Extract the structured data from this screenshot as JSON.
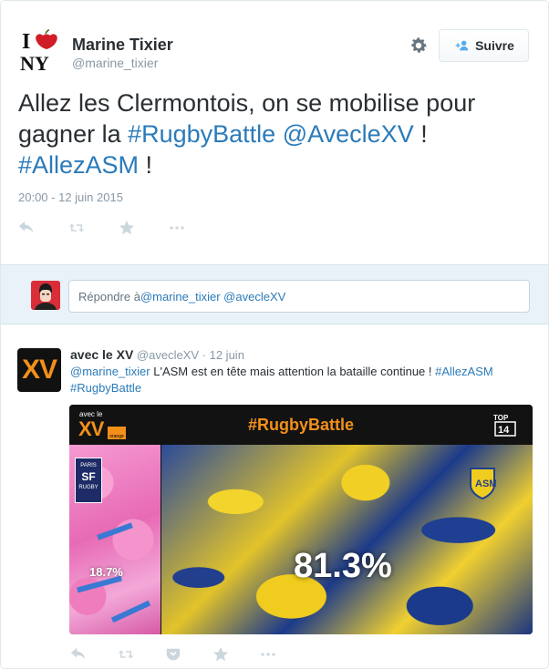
{
  "main_tweet": {
    "author_name": "Marine Tixier",
    "author_handle": "@marine_tixier",
    "follow_label": "Suivre",
    "text_parts": [
      {
        "text": "Allez les Clermontois, on se mobilise pour gagner la ",
        "link": false
      },
      {
        "text": "#RugbyBattle",
        "link": true
      },
      {
        "text": " ",
        "link": false
      },
      {
        "text": "@AvecleXV",
        "link": true
      },
      {
        "text": " ! ",
        "link": false
      },
      {
        "text": "#AllezASM",
        "link": true
      },
      {
        "text": " !",
        "link": false
      }
    ],
    "timestamp": "20:00 - 12 juin 2015",
    "logo_text_top": "I",
    "logo_text_bottom": "NY"
  },
  "reply_box": {
    "prefix": "Répondre à ",
    "mentions": "@marine_tixier @avecleXV"
  },
  "reply_tweet": {
    "author_name": "avec le XV",
    "author_handle": "@avecleXV",
    "date": "12 juin",
    "avatar_text": "XV",
    "text_parts": [
      {
        "text": "@marine_tixier",
        "link": true
      },
      {
        "text": " L'ASM est en tête mais attention la bataille continue ! ",
        "link": false
      },
      {
        "text": "#AllezASM",
        "link": true
      },
      {
        "text": " ",
        "link": false
      },
      {
        "text": "#RugbyBattle",
        "link": true
      }
    ],
    "media": {
      "brand_small": "avec le",
      "brand_big": "XV",
      "brand_orange": "orange",
      "title": "#RugbyBattle",
      "top_logo": "TOP 14",
      "left_club": "PARIS",
      "left_club_sub": "RUGBY",
      "left_percent": "18.7%",
      "right_percent": "81.3%",
      "colors": {
        "pink": "#ef7dbe",
        "yellow": "#f0cc1e",
        "blue": "#1f3f92",
        "orange": "#f39019"
      }
    }
  },
  "icons": [
    "i-love-ny-logo",
    "gear-icon",
    "follow-icon",
    "reply-icon",
    "retweet-icon",
    "favorite-icon",
    "more-icon",
    "pocket-icon"
  ]
}
